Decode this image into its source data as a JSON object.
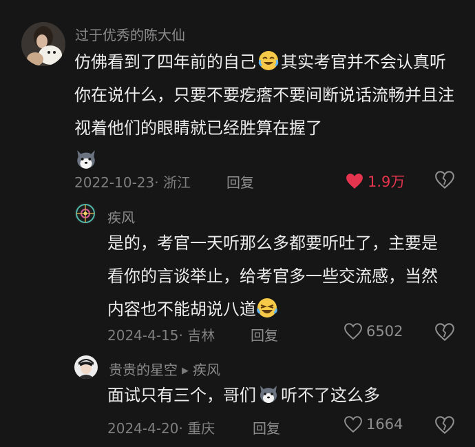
{
  "comments": [
    {
      "username": "过于优秀的陈大仙",
      "text_part1": "仿佛看到了四年前的自己",
      "text_part2": "其实考官并不会认真听你在说什么，只要不要疙瘩不要间断说话流畅并且注视着他们的眼睛就已经胜算在握了",
      "meta": "2022-10-23· 浙江",
      "reply_label": "回复",
      "likes": "1.9万",
      "liked": true
    }
  ],
  "replies": [
    {
      "username": "疾风",
      "text_part1": "是的，考官一天听那么多都要听吐了，主要是看你的言谈举止，给考官多一些交流感，当然内容也不能胡说八道",
      "meta": "2024-4-15· 吉林",
      "reply_label": "回复",
      "likes": "6502",
      "liked": false
    },
    {
      "username": "贵贵的星空",
      "reply_to": "疾风",
      "text_part1": "面试只有三个，哥们",
      "text_part2": "听不了这么多",
      "meta": "2024-4-20· 重庆",
      "reply_label": "回复",
      "likes": "1664",
      "liked": false
    }
  ],
  "colors": {
    "background": "#161616",
    "like_active": "#e5344e",
    "muted_text": "#8b8b8b"
  },
  "icons": [
    "crying-laughing-emoji",
    "husky-emoji",
    "heart-icon",
    "broken-heart-icon",
    "laughing-emoji",
    "play-arrow-icon"
  ]
}
